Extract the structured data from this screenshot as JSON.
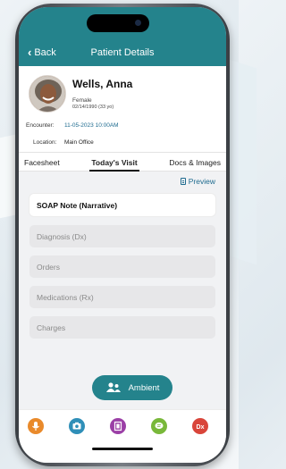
{
  "header": {
    "back_label": "Back",
    "title": "Patient Details"
  },
  "patient": {
    "name": "Wells, Anna",
    "gender": "Female",
    "dob": "02/14/1990 (33 yo)",
    "encounter_label": "Encounter:",
    "encounter_value": "11-05-2023 10:00AM",
    "location_label": "Location:",
    "location_value": "Main Office"
  },
  "tabs": [
    {
      "label": "Facesheet",
      "active": false
    },
    {
      "label": "Today's Visit",
      "active": true
    },
    {
      "label": "Docs & Images",
      "active": false
    }
  ],
  "preview_label": "Preview",
  "sections": [
    {
      "label": "SOAP Note (Narrative)",
      "primary": true
    },
    {
      "label": "Diagnosis (Dx)",
      "primary": false
    },
    {
      "label": "Orders",
      "primary": false
    },
    {
      "label": "Medications (Rx)",
      "primary": false
    },
    {
      "label": "Charges",
      "primary": false
    }
  ],
  "ambient_label": "Ambient",
  "toolbar": {
    "buttons": [
      {
        "name": "microphone-icon",
        "color": "#e98a2b"
      },
      {
        "name": "camera-icon",
        "color": "#2f8fb8"
      },
      {
        "name": "scan-document-icon",
        "color": "#9b3fa6"
      },
      {
        "name": "chat-icon",
        "color": "#79b83a"
      },
      {
        "name": "prescription-icon",
        "color": "#d9453a",
        "glyph": "Dx"
      }
    ]
  },
  "colors": {
    "brand": "#24838c",
    "link": "#1e6b8f"
  }
}
